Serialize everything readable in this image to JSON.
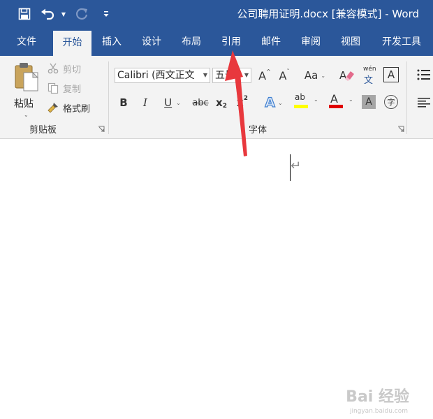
{
  "window": {
    "title": "公司聘用证明.docx [兼容模式] - Word",
    "accent_color": "#2b579a",
    "annotation_arrow_color": "#e8383d"
  },
  "qat": {
    "save_icon": "save-icon",
    "undo_icon": "undo-icon",
    "redo_icon": "redo-icon",
    "customize_icon": "customize-qat-icon"
  },
  "tabs": [
    {
      "label": "文件",
      "active": false
    },
    {
      "label": "开始",
      "active": true
    },
    {
      "label": "插入",
      "active": false
    },
    {
      "label": "设计",
      "active": false
    },
    {
      "label": "布局",
      "active": false
    },
    {
      "label": "引用",
      "active": false
    },
    {
      "label": "邮件",
      "active": false
    },
    {
      "label": "审阅",
      "active": false
    },
    {
      "label": "视图",
      "active": false
    },
    {
      "label": "开发工具",
      "active": false
    }
  ],
  "clipboard": {
    "paste_label": "粘贴",
    "cut_label": "剪切",
    "copy_label": "复制",
    "format_painter_label": "格式刷",
    "group_label": "剪贴板"
  },
  "font": {
    "font_name": "Calibri (西文正文",
    "font_size": "五号",
    "group_label": "字体",
    "grow_font": "A",
    "shrink_font": "A",
    "change_case": "Aa",
    "phonetic_guide_top": "wén",
    "phonetic_guide_bottom": "文",
    "char_border": "A",
    "bold": "B",
    "italic": "I",
    "underline": "U",
    "strikethrough": "abc",
    "subscript": "x",
    "subscript_sub": "2",
    "superscript": "x",
    "superscript_sup": "2",
    "text_effects": "A",
    "highlight": "ab",
    "highlight_color": "#ffff00",
    "font_color": "A",
    "font_color_value": "#e00000",
    "char_shading": "A",
    "enclose_char": "字"
  },
  "document": {
    "paragraph_mark": "↵"
  },
  "watermark": {
    "text": "Bai 经验",
    "sub": "jingyan.baidu.com"
  }
}
